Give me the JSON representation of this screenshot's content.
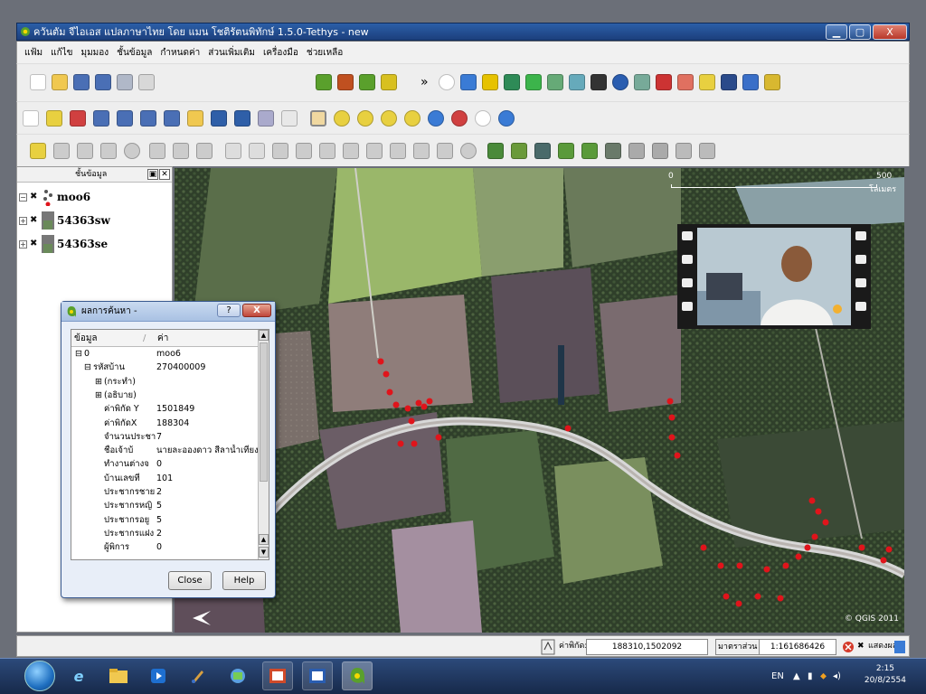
{
  "window": {
    "title": "ควันตัม จีไอเอส แปลภาษาไทย โดย แมน โชติรัตนพิทักษ์ 1.5.0-Tethys - new",
    "minimize": "▁",
    "maximize": "▢",
    "close": "X"
  },
  "menubar": {
    "items": [
      "แฟ้ม",
      "แก้ไข",
      "มุมมอง",
      "ชั้นข้อมูล",
      "กำหนดค่า",
      "ส่วนเพิ่มเติม",
      "เครื่องมือ",
      "ช่วยเหลือ"
    ]
  },
  "toolbar": {
    "overflow": "»"
  },
  "layers_panel": {
    "title": "ชั้นข้อมูล",
    "float_btn": "▣",
    "close_btn": "✕",
    "layers": [
      {
        "name": "moo6",
        "checked": "✖",
        "expander": "−"
      },
      {
        "name": "54363sw",
        "checked": "✖",
        "expander": "+"
      },
      {
        "name": "54363se",
        "checked": "✖",
        "expander": "+"
      }
    ]
  },
  "map": {
    "scale_start": "0",
    "scale_end": "500",
    "scale_unit": "โลเมตร",
    "copyright": "© QGIS 2011",
    "colors": {
      "point": "#e0141b",
      "road": "#d8d8d8"
    }
  },
  "identify_dialog": {
    "title": "ผลการค้นหา -",
    "help_btn": "?",
    "close_x": "X",
    "col_feature": "ข้อมูล",
    "col_separator": "/",
    "col_value": "ค่า",
    "rows": [
      {
        "key": "0",
        "value": "moo6",
        "prefix": "⊟"
      },
      {
        "key": "รหัสบ้าน",
        "value": "270400009",
        "prefix": "⊟"
      },
      {
        "key": "(กระทำ)",
        "value": "",
        "prefix": "⊞"
      },
      {
        "key": "(อธิบาย)",
        "value": "",
        "prefix": "⊞"
      },
      {
        "key": "ค่าพิกัด Y",
        "value": "1501849",
        "prefix": ""
      },
      {
        "key": "ค่าพิกัดX",
        "value": "188304",
        "prefix": ""
      },
      {
        "key": "จำนวนประชา",
        "value": "7",
        "prefix": ""
      },
      {
        "key": "ชื่อเจ้าบ้",
        "value": "นายละอองดาว สีลาน้ำเที่ยง",
        "prefix": ""
      },
      {
        "key": "ทำงานต่างจ",
        "value": "0",
        "prefix": ""
      },
      {
        "key": "บ้านเลขที่",
        "value": "101",
        "prefix": ""
      },
      {
        "key": "ประชากรชาย",
        "value": "2",
        "prefix": ""
      },
      {
        "key": "ประชากรหญิ",
        "value": "5",
        "prefix": ""
      },
      {
        "key": "ประชากรอยู",
        "value": "5",
        "prefix": ""
      },
      {
        "key": "ประชากรแฝง",
        "value": "2",
        "prefix": ""
      },
      {
        "key": "ผู้พิการ",
        "value": "0",
        "prefix": ""
      }
    ],
    "close_button": "Close",
    "help_button": "Help"
  },
  "statusbar": {
    "coord_label": "ค่าพิกัด:",
    "coords": "188310,1502092",
    "scale_label": "มาตราส่วน",
    "scale_value": "1:161686426",
    "render_label": "แสดงผล",
    "render_check": "✖"
  },
  "taskbar": {
    "lang": "EN",
    "time": "2:15",
    "date": "20/8/2554"
  }
}
